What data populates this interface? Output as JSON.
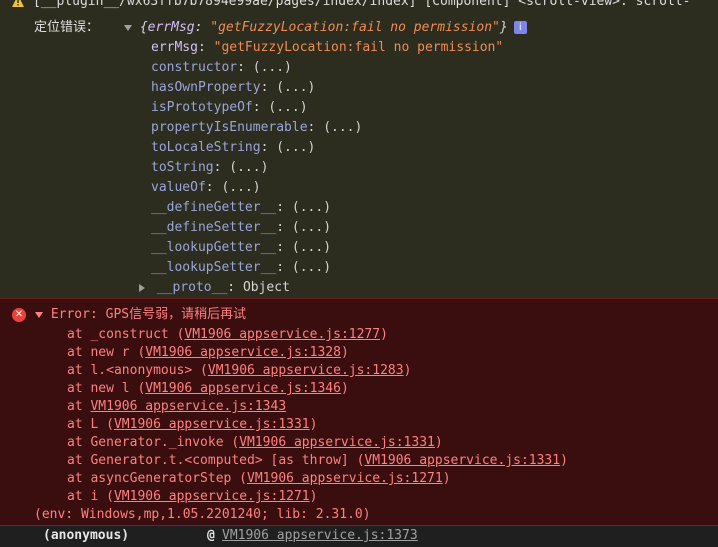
{
  "header": {
    "text": "[__plugin__/wx63ffb7b7894e99ae/pages/index/index] [Component] <scroll-view>: scroll-"
  },
  "object_log": {
    "label": "定位错误：",
    "summary_open": "{",
    "summary_key": "errMsg",
    "summary_colon": ": ",
    "summary_value": "\"getFuzzyLocation:fail no permission\"",
    "summary_close": "}",
    "info_badge": "i",
    "own_property": {
      "key": "errMsg",
      "value": "\"getFuzzyLocation:fail no permission\""
    },
    "properties": [
      {
        "key": "constructor",
        "value": "(...)"
      },
      {
        "key": "hasOwnProperty",
        "value": "(...)"
      },
      {
        "key": "isPrototypeOf",
        "value": "(...)"
      },
      {
        "key": "propertyIsEnumerable",
        "value": "(...)"
      },
      {
        "key": "toLocaleString",
        "value": "(...)"
      },
      {
        "key": "toString",
        "value": "(...)"
      },
      {
        "key": "valueOf",
        "value": "(...)"
      },
      {
        "key": "__defineGetter__",
        "value": "(...)"
      },
      {
        "key": "__defineSetter__",
        "value": "(...)"
      },
      {
        "key": "__lookupGetter__",
        "value": "(...)"
      },
      {
        "key": "__lookupSetter__",
        "value": "(...)"
      }
    ],
    "proto": {
      "key": "__proto__",
      "value": "Object"
    }
  },
  "error": {
    "icon": "✕",
    "message": "Error: GPS信号弱，请稍后再试",
    "frames": [
      {
        "prefix": "at _construct (",
        "link": "VM1906 appservice.js:1277",
        "suffix": ")"
      },
      {
        "prefix": "at new r (",
        "link": "VM1906 appservice.js:1328",
        "suffix": ")"
      },
      {
        "prefix": "at l.<anonymous> (",
        "link": "VM1906 appservice.js:1283",
        "suffix": ")"
      },
      {
        "prefix": "at new l (",
        "link": "VM1906 appservice.js:1346",
        "suffix": ")"
      },
      {
        "prefix": "at ",
        "link": "VM1906 appservice.js:1343",
        "suffix": ""
      },
      {
        "prefix": "at L (",
        "link": "VM1906 appservice.js:1331",
        "suffix": ")"
      },
      {
        "prefix": "at Generator._invoke (",
        "link": "VM1906 appservice.js:1331",
        "suffix": ")"
      },
      {
        "prefix": "at Generator.t.<computed> [as throw] (",
        "link": "VM1906 appservice.js:1331",
        "suffix": ")"
      },
      {
        "prefix": "at asyncGeneratorStep (",
        "link": "VM1906 appservice.js:1271",
        "suffix": ")"
      },
      {
        "prefix": "at i (",
        "link": "VM1906 appservice.js:1271",
        "suffix": ")"
      }
    ],
    "env": "(env: Windows,mp,1.05.2201240; lib: 2.31.0)"
  },
  "bottom": {
    "function": "(anonymous)",
    "at": "@",
    "source": "VM1906 appservice.js:1373"
  }
}
